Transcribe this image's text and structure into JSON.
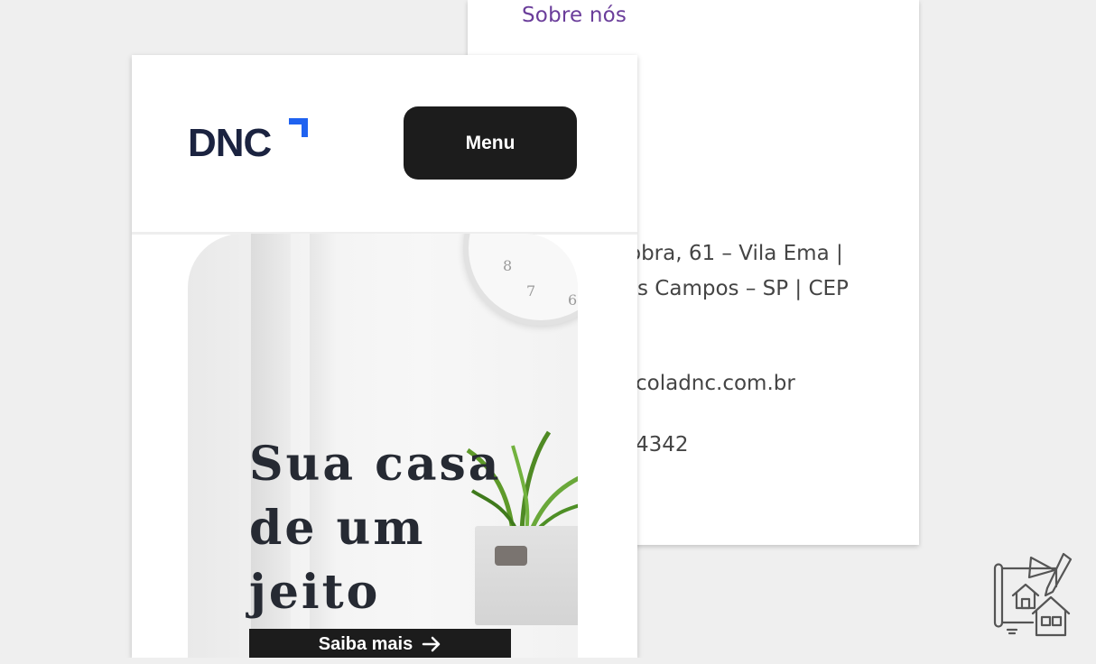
{
  "back_page": {
    "nav_link": "Sobre nós",
    "address_line1": "obra, 61 – Vila Ema |",
    "address_line2": "s Campos – SP | CEP",
    "email_fragment": "coladnc.com.br",
    "phone_fragment": "4342"
  },
  "front_page": {
    "logo_text": "DNC",
    "menu_label": "Menu",
    "hero_title_line1": "Sua casa",
    "hero_title_line2": "de um",
    "hero_title_line3": "jeito",
    "cta_label": "Saiba mais",
    "cta_icon": "arrow-right-icon",
    "clock_numbers": [
      "8",
      "7",
      "6"
    ]
  },
  "colors": {
    "nav_link": "#6a3d9a",
    "logo": "#1b2340",
    "logo_accent": "#1f62f0",
    "button_bg": "#1c1c1c",
    "page_bg": "#efefef"
  },
  "icons": {
    "corner": "house-design-tools-icon"
  }
}
